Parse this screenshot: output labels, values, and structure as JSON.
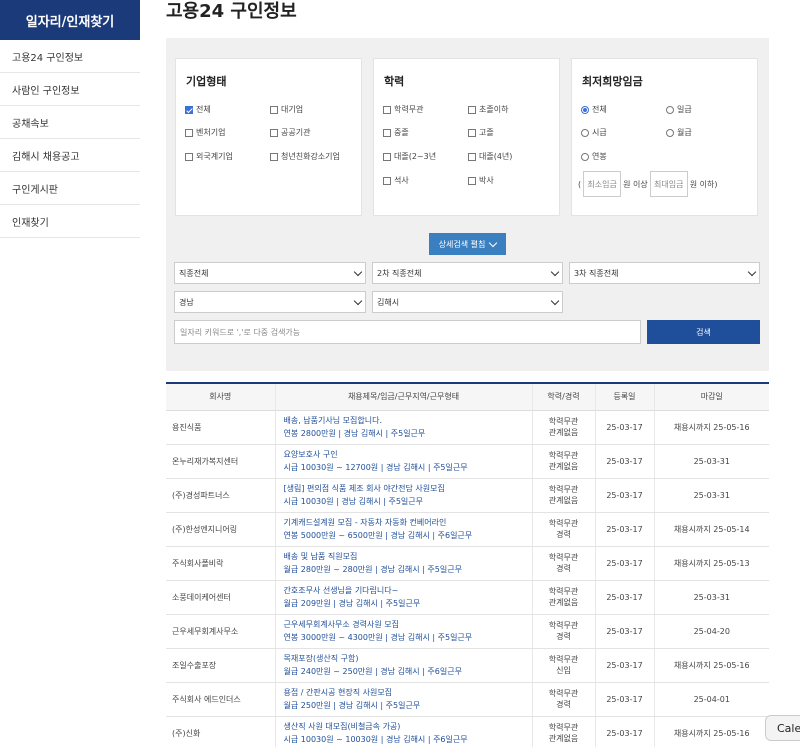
{
  "sidebar": {
    "title": "일자리/인재찾기",
    "items": [
      "고용24 구인정보",
      "사람인 구인정보",
      "공채속보",
      "김해시 채용공고",
      "구인게시판",
      "인재찾기"
    ]
  },
  "page_title": "고용24 구인정보",
  "filters": {
    "company_type": {
      "title": "기업형태",
      "options": [
        {
          "label": "전체",
          "checked": true
        },
        {
          "label": "대기업",
          "checked": false
        },
        {
          "label": "벤처기업",
          "checked": false
        },
        {
          "label": "공공기관",
          "checked": false
        },
        {
          "label": "외국계기업",
          "checked": false
        },
        {
          "label": "청년친화강소기업",
          "checked": false
        }
      ]
    },
    "education": {
      "title": "학력",
      "options": [
        {
          "label": "학력무관",
          "checked": false
        },
        {
          "label": "초졸이하",
          "checked": false
        },
        {
          "label": "중졸",
          "checked": false
        },
        {
          "label": "고졸",
          "checked": false
        },
        {
          "label": "대졸(2~3년",
          "checked": false
        },
        {
          "label": "대졸(4년)",
          "checked": false
        },
        {
          "label": "석사",
          "checked": false
        },
        {
          "label": "박사",
          "checked": false
        }
      ]
    },
    "wage": {
      "title": "최저희망임금",
      "options": [
        {
          "label": "전체",
          "checked": true
        },
        {
          "label": "일급",
          "checked": false
        },
        {
          "label": "시급",
          "checked": false
        },
        {
          "label": "월급",
          "checked": false
        },
        {
          "label": "연봉",
          "checked": false
        }
      ],
      "paren_open": "(",
      "min_placeholder": "최소임금",
      "won_above": "원 이상",
      "max_placeholder": "최대임금",
      "won_below": "원 이하)"
    }
  },
  "detail_button": "상세검색 펼침",
  "selects": {
    "job1": "직종전체",
    "job2": "2차 직종전체",
    "job3": "3차 직종전체",
    "region1": "경남",
    "region2": "김해시"
  },
  "keyword_placeholder": "일자리 키워드로 ','로 다중 검색가능",
  "search_button": "검색",
  "table": {
    "headers": [
      "회사명",
      "채용제목/임금/근무지역/근무형태",
      "학력/경력",
      "등록일",
      "마감일"
    ],
    "rows": [
      {
        "company": "용진식품",
        "title": "배송, 납품기사님 모집합니다.",
        "detail": "연봉 2800만원 | 경남 김해시 | 주5일근무",
        "edu": "학력무관",
        "career": "관계없음",
        "reg": "25-03-17",
        "deadline": "채용시까지 25-05-16"
      },
      {
        "company": "온누리재가복지센터",
        "title": "요양보호사 구인",
        "detail": "시급 10030원 ~ 12700원 | 경남 김해시 | 주5일근무",
        "edu": "학력무관",
        "career": "관계없음",
        "reg": "25-03-17",
        "deadline": "25-03-31"
      },
      {
        "company": "(주)경성파트너스",
        "title": "[생림] 편의점 식품 제조 회사 야간전담 사원모집",
        "detail": "시급 10030원 | 경남 김해시 | 주5일근무",
        "edu": "학력무관",
        "career": "관계없음",
        "reg": "25-03-17",
        "deadline": "25-03-31"
      },
      {
        "company": "(주)한성엔지니어링",
        "title": "기계캐드설계원 모집 - 자동차 자동화 컨베어라인",
        "detail": "연봉 5000만원 ~ 6500만원 | 경남 김해시 | 주6일근무",
        "edu": "학력무관",
        "career": "경력",
        "reg": "25-03-17",
        "deadline": "채용시까지 25-05-14"
      },
      {
        "company": "주식회사폴비락",
        "title": "배송 및 납품 직원모집",
        "detail": "월급 280만원 ~ 280만원 | 경남 김해시 | 주5일근무",
        "edu": "학력무관",
        "career": "경력",
        "reg": "25-03-17",
        "deadline": "채용시까지 25-05-13"
      },
      {
        "company": "소풍데이케어센터",
        "title": "간호조무사 선생님을 기다립니다~",
        "detail": "월급 209만원 | 경남 김해시 | 주5일근무",
        "edu": "학력무관",
        "career": "관계없음",
        "reg": "25-03-17",
        "deadline": "25-03-31"
      },
      {
        "company": "근우세무회계사무소",
        "title": "근우세무회계사무소 경력사원 모집",
        "detail": "연봉 3000만원 ~ 4300만원 | 경남 김해시 | 주5일근무",
        "edu": "학력무관",
        "career": "경력",
        "reg": "25-03-17",
        "deadline": "25-04-20"
      },
      {
        "company": "조일수출포장",
        "title": "목재포장(생산직 구함)",
        "detail": "월급 240만원 ~ 250만원 | 경남 김해시 | 주6일근무",
        "edu": "학력무관",
        "career": "신입",
        "reg": "25-03-17",
        "deadline": "채용시까지 25-05-16"
      },
      {
        "company": "주식회사 에드인더스",
        "title": "용접 / 간판시공 현장직 사원모집",
        "detail": "월급 250만원 | 경남 김해시 | 주5일근무",
        "edu": "학력무관",
        "career": "경력",
        "reg": "25-03-17",
        "deadline": "25-04-01"
      },
      {
        "company": "(주)신화",
        "title": "생산직 사원 대모집(비철금속 가공)",
        "detail": "시급 10030원 ~ 10030원 | 경남 김해시 | 주6일근무",
        "edu": "학력무관",
        "career": "관계없음",
        "reg": "25-03-17",
        "deadline": "채용시까지 25-05-16"
      }
    ]
  },
  "overlay_button": "Cale"
}
